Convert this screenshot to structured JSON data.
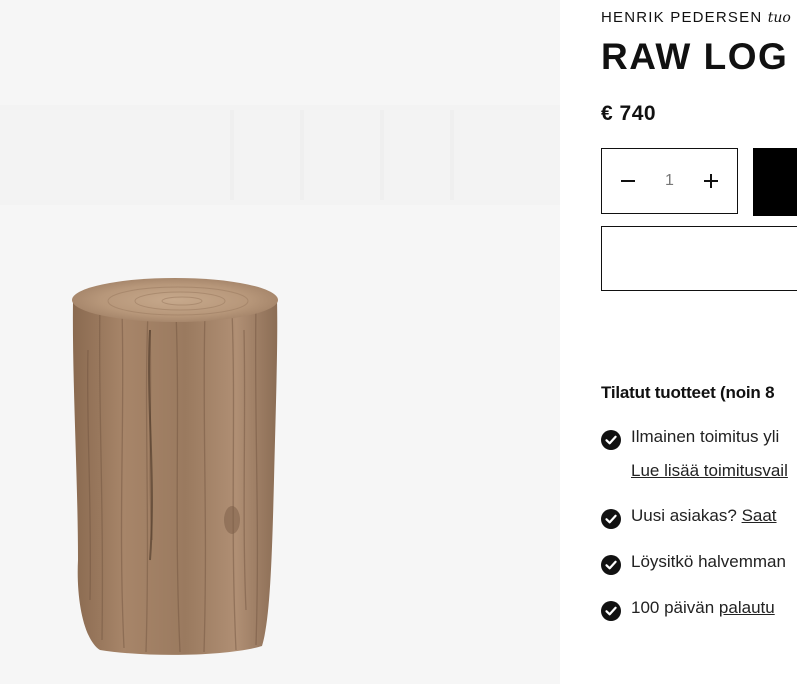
{
  "product": {
    "brand": "HENRIK PEDERSEN",
    "brand_suffix": "tuo",
    "title": "RAW LOG",
    "price": "€ 740",
    "image_alt": "Raw wooden log side table"
  },
  "quantity": {
    "value": "1",
    "decrement_icon": "minus-icon",
    "increment_icon": "plus-icon"
  },
  "shipping": {
    "heading": "Tilatut tuotteet (noin 8",
    "items": [
      {
        "text": "Ilmainen toimitus yli",
        "link": "Lue lisää toimitusvail"
      },
      {
        "text": "Uusi asiakas?",
        "link": "Saat"
      },
      {
        "text": "Löysitkö halvemman"
      },
      {
        "text": "100 päivän",
        "link": "palautu"
      }
    ],
    "check_icon": "check-circle-icon"
  }
}
